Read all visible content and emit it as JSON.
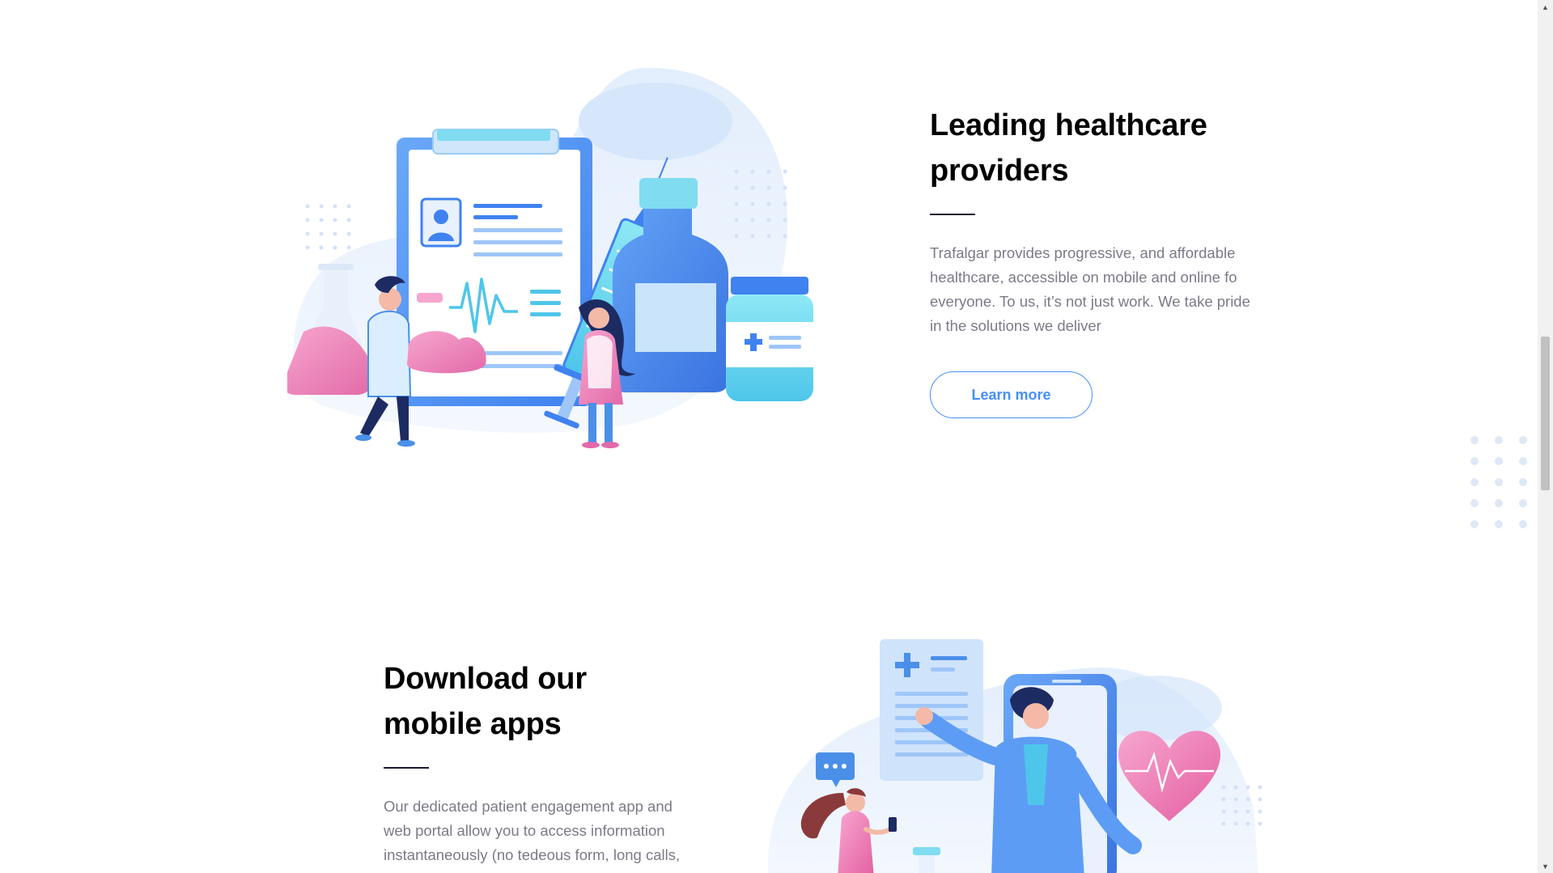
{
  "section1": {
    "title_line1": "Leading healthcare",
    "title_line2": "providers",
    "description": "Trafalgar provides progressive, and affordable healthcare, accessible on mobile and online fo everyone. To us, it’s not just work. We take pride in the solutions we deliver",
    "button_label": "Learn more"
  },
  "section2": {
    "title_line1": "Download our",
    "title_line2": "mobile apps",
    "description": "Our dedicated patient engagement app and web portal allow you to access information instantaneously (no tedeous form, long calls,"
  },
  "colors": {
    "accent": "#458ff6",
    "heading": "#000000",
    "body_text": "#7d7987",
    "divider": "#1f1534"
  },
  "icons": {
    "scroll_up": "▲",
    "scroll_down": "▼"
  }
}
